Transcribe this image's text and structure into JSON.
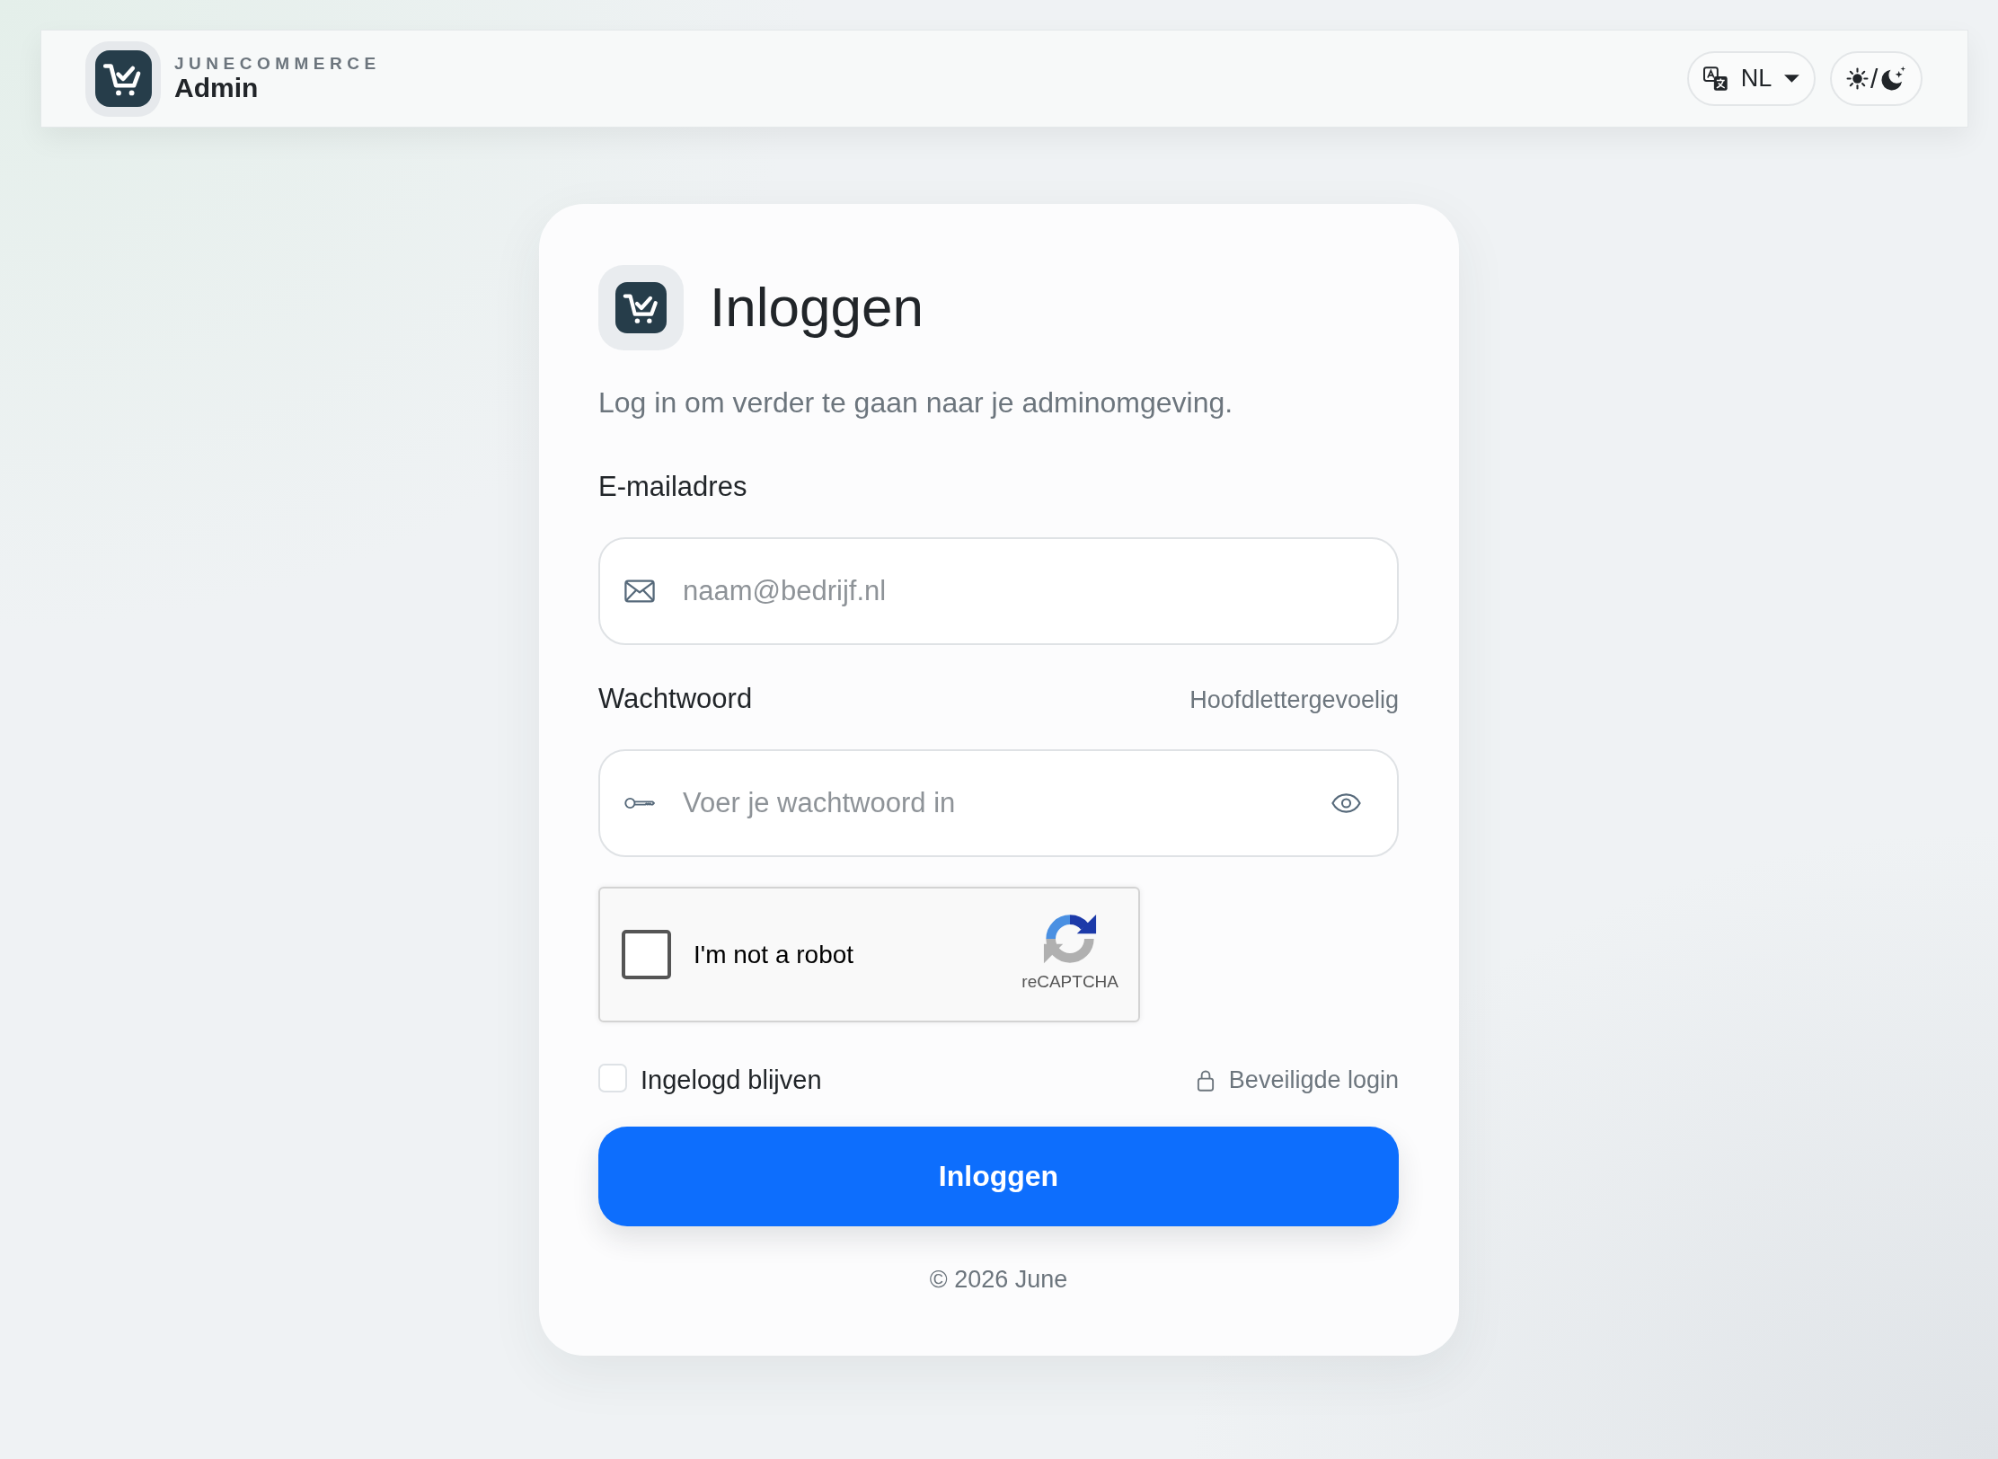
{
  "header": {
    "brand": "JUNECOMMERCE",
    "product": "Admin",
    "language": "NL",
    "theme_toggle": "/"
  },
  "login": {
    "title": "Inloggen",
    "intro": "Log in om verder te gaan naar je adminomgeving.",
    "fields": [
      {
        "kind": "email",
        "label": "E-mailadres",
        "placeholder": "naam@bedrijf.nl"
      },
      {
        "kind": "password",
        "label": "Wachtwoord",
        "hint": "Hoofdlettergevoelig",
        "placeholder": "Voer je wachtwoord in"
      }
    ],
    "captcha": {
      "label": "I'm not a robot",
      "checked": false,
      "brand": "reCAPTCHA"
    },
    "remember": {
      "label": "Ingelogd blijven",
      "checked": false
    },
    "security_note": "Beveiligde login",
    "submit": "Inloggen",
    "footer": "© 2026 June"
  }
}
